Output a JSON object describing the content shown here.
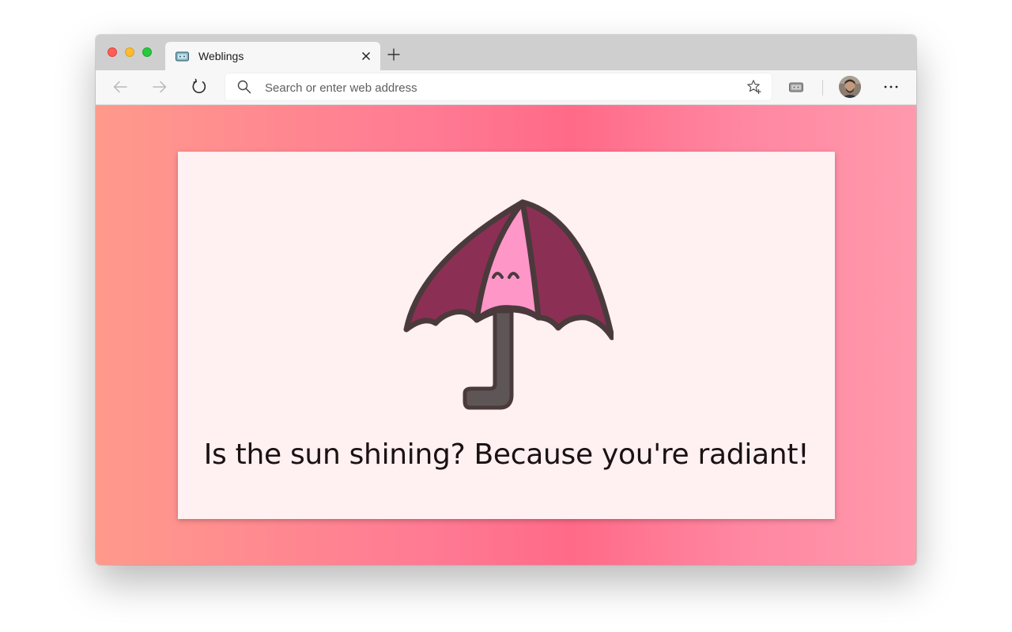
{
  "browser": {
    "tab": {
      "title": "Weblings",
      "favicon": "umbrella-favicon-icon"
    },
    "toolbar": {
      "back_icon": "arrow-left-icon",
      "forward_icon": "arrow-right-icon",
      "reload_icon": "refresh-icon",
      "address_placeholder": "Search or enter web address",
      "favorite_icon": "star-add-icon",
      "extension_icon": "collections-icon",
      "menu_icon": "more-horizontal-icon"
    },
    "window_controls": [
      "close",
      "minimize",
      "maximize"
    ]
  },
  "page": {
    "message": "Is the sun shining? Because you're radiant!",
    "illustration": "umbrella-icon",
    "colors": {
      "gradient_start": "#ff9a8b",
      "gradient_mid": "#ff6a88",
      "gradient_end": "#ff99ac",
      "card_background": "#fff0f2",
      "umbrella_dark": "#8c2f55",
      "umbrella_light": "#ff96c8",
      "outline": "#4a3a3c"
    }
  }
}
